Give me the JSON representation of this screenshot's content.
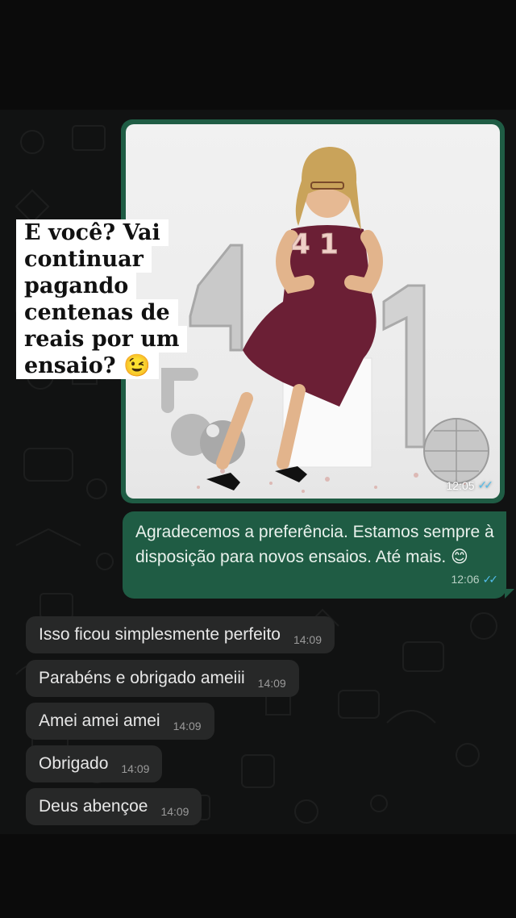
{
  "overlay_caption": {
    "lines": [
      "E você? Vai",
      "continuar",
      "pagando",
      "centenas de",
      "reais por um",
      "ensaio? 😉"
    ]
  },
  "image_message": {
    "time": "12:05",
    "status_icon": "double-check-read-icon",
    "balloon_numbers": "41",
    "candle_numbers": "41"
  },
  "outgoing_message": {
    "text": "Agradecemos a preferência. Estamos sempre à disposição para novos ensaios. Até mais. 😊",
    "time": "12:06",
    "status_icon": "double-check-read-icon"
  },
  "incoming_messages": [
    {
      "text": "Isso ficou simplesmente perfeito",
      "time": "14:09"
    },
    {
      "text": "Parabéns e obrigado ameiii",
      "time": "14:09"
    },
    {
      "text": "Amei amei amei",
      "time": "14:09"
    },
    {
      "text": "Obrigado",
      "time": "14:09"
    },
    {
      "text": "Deus abençoe",
      "time": "14:09"
    }
  ],
  "colors": {
    "outgoing_bubble": "#1f5c44",
    "incoming_bubble": "#272828",
    "chat_background": "#111212",
    "read_ticks": "#53bdeb"
  }
}
